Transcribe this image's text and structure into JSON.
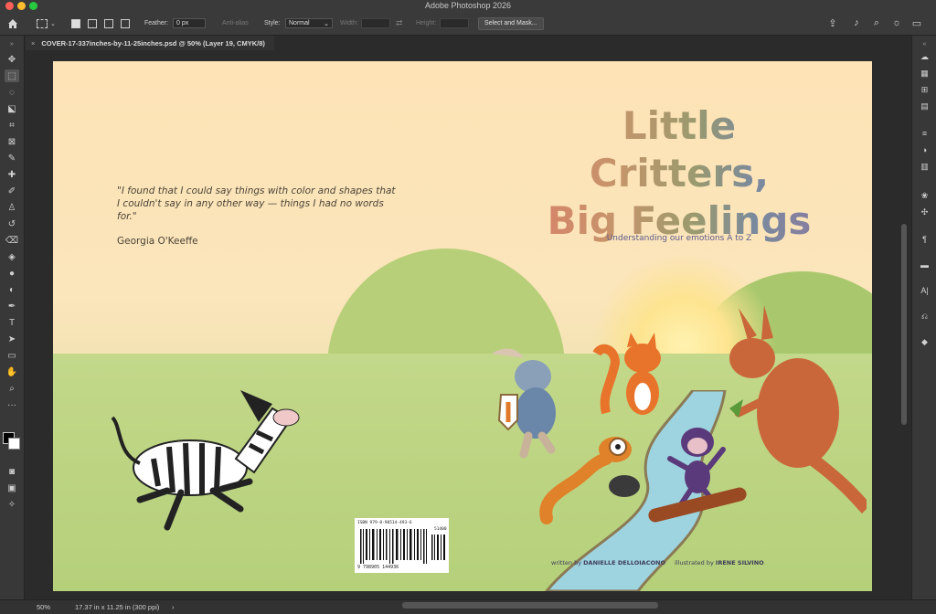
{
  "app": {
    "title": "Adobe Photoshop 2026"
  },
  "options_bar": {
    "feather_label": "Feather:",
    "feather_value": "0 px",
    "anti_alias_label": "Anti-alias",
    "style_label": "Style:",
    "style_value": "Normal",
    "width_label": "Width:",
    "height_label": "Height:",
    "select_mask_label": "Select and Mask..."
  },
  "document": {
    "tab_label": "COVER-17-337inches-by-11-25inches.psd @ 50% (Layer 19, CMYK/8)"
  },
  "status": {
    "zoom": "50%",
    "doc_info": "17.37 in x 11.25 in (300 ppi)"
  },
  "cover": {
    "quote": "\"I found that I could say things with color and shapes that I couldn't say in any other way — things I had no words for.\"",
    "quote_author": "Georgia O'Keeffe",
    "title_line1": "Little Critters,",
    "title_line2": "Big Feelings",
    "subtitle": "Understanding our emotions A to Z",
    "written_by_label": "written by",
    "author": "DANIELLE DELLOIACONO",
    "illustrated_by_label": "illustrated by",
    "illustrator": "IRENE SILVINO",
    "isbn": "ISBN 979-8-90514-493-6",
    "price_code": "51400",
    "barcode_number": "9 798905 144936"
  },
  "colors": {
    "ui_dark": "#2b2b2b",
    "panel": "#383838",
    "title_warm": "#d9826a",
    "title_cool": "#8a7aa0",
    "subtitle": "#5a5a8a"
  }
}
